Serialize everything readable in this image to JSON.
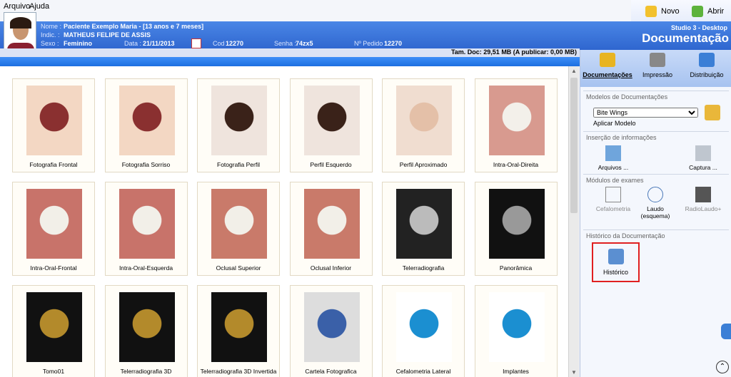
{
  "menu": {
    "file": "Arquivo",
    "help": "Ajuda"
  },
  "topbar": {
    "new": "Novo",
    "open": "Abrir"
  },
  "patient": {
    "name_label": "Nome :",
    "name": "Paciente Exemplo Maria - [13 anos e 7 meses]",
    "indic_label": "Indic. :",
    "indic": "MATHEUS FELIPE DE ASSIS",
    "sex_label": "Sexo :",
    "sex": "Feminino",
    "date_label": "Data :",
    "date": "21/11/2013",
    "cod_label": "Cod",
    "cod": "12270",
    "senha_label": "Senha :",
    "senha": "74zx5",
    "pedido_label": "Nº Pedido :",
    "pedido": "12270"
  },
  "studio": "Studio 3 - Desktop",
  "title": "Documentação",
  "size_info": "Tam. Doc: 29,51 MB (A publicar: 0,00 MB)",
  "gallery": [
    "Fotografia Frontal",
    "Fotografia Sorriso",
    "Fotografia Perfil",
    "Perfil Esquerdo",
    "Perfil Aproximado",
    "Intra-Oral-Direita",
    "Intra-Oral-Frontal",
    "Intra-Oral-Esquerda",
    "Oclusal Superior",
    "Oclusal Inferior",
    "Telerradiografia",
    "Panorâmica",
    "Tomo01",
    "Telerradiografia 3D",
    "Telerradiografia 3D Invertida",
    "Cartela Fotografica",
    "Cefalometria Lateral",
    "Implantes"
  ],
  "tabs": {
    "doc": "Documentações",
    "print": "Impressão",
    "dist": "Distribuição"
  },
  "models": {
    "title": "Modelos de Documentações",
    "selected": "Bite Wings",
    "apply": "Aplicar Modelo"
  },
  "insert": {
    "title": "Inserção de informações",
    "files": "Arquivos ...",
    "capture": "Captura ..."
  },
  "exams": {
    "title": "Módulos de exames",
    "cef": "Cefalometria",
    "laudo": "Laudo (esquema)",
    "radio": "RadioLaudo+"
  },
  "history": {
    "title": "Histórico da Documentação",
    "btn": "Histórico"
  }
}
